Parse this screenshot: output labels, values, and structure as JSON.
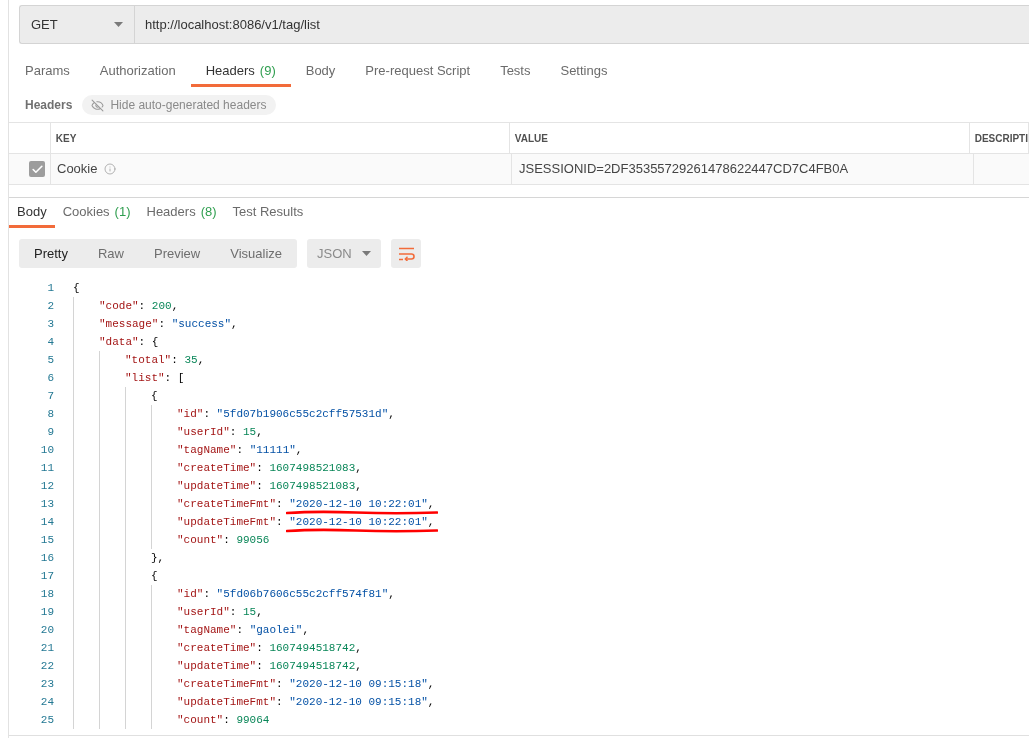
{
  "request": {
    "method": "GET",
    "url": "http://localhost:8086/v1/tag/list"
  },
  "request_tabs": [
    {
      "label": "Params",
      "selected": false
    },
    {
      "label": "Authorization",
      "selected": false
    },
    {
      "label": "Headers",
      "count": "(9)",
      "selected": true
    },
    {
      "label": "Body",
      "selected": false
    },
    {
      "label": "Pre-request Script",
      "selected": false
    },
    {
      "label": "Tests",
      "selected": false
    },
    {
      "label": "Settings",
      "selected": false
    }
  ],
  "headers_section": {
    "title": "Headers",
    "toggle": "Hide auto-generated headers"
  },
  "headers_table": {
    "columns": [
      "KEY",
      "VALUE",
      "DESCRIPTI"
    ],
    "rows": [
      {
        "checked": true,
        "key": "Cookie",
        "value": "JSESSIONID=2DF35355729261478622447CD7C4FB0A"
      }
    ]
  },
  "response_tabs": [
    {
      "label": "Body",
      "selected": true
    },
    {
      "label": "Cookies",
      "count": "(1)",
      "selected": false
    },
    {
      "label": "Headers",
      "count": "(8)",
      "selected": false
    },
    {
      "label": "Test Results",
      "selected": false
    }
  ],
  "view_modes": [
    {
      "label": "Pretty",
      "selected": true
    },
    {
      "label": "Raw",
      "selected": false
    },
    {
      "label": "Preview",
      "selected": false
    },
    {
      "label": "Visualize",
      "selected": false
    }
  ],
  "format": "JSON",
  "code": {
    "lines": [
      {
        "number": "1",
        "underlined": false,
        "tokens": [
          {
            "kind": "punct",
            "text": "{"
          }
        ],
        "children": [
          {
            "number": "2",
            "underlined": false,
            "tokens": [
              {
                "kind": "key",
                "text": "\"code\""
              },
              {
                "kind": "punct",
                "text": ": "
              },
              {
                "kind": "number",
                "text": "200"
              },
              {
                "kind": "punct",
                "text": ","
              }
            ]
          },
          {
            "number": "3",
            "underlined": false,
            "tokens": [
              {
                "kind": "key",
                "text": "\"message\""
              },
              {
                "kind": "punct",
                "text": ": "
              },
              {
                "kind": "string",
                "text": "\"success\""
              },
              {
                "kind": "punct",
                "text": ","
              }
            ]
          },
          {
            "number": "4",
            "underlined": false,
            "tokens": [
              {
                "kind": "key",
                "text": "\"data\""
              },
              {
                "kind": "punct",
                "text": ": {"
              }
            ],
            "children": [
              {
                "number": "5",
                "underlined": false,
                "tokens": [
                  {
                    "kind": "key",
                    "text": "\"total\""
                  },
                  {
                    "kind": "punct",
                    "text": ": "
                  },
                  {
                    "kind": "number",
                    "text": "35"
                  },
                  {
                    "kind": "punct",
                    "text": ","
                  }
                ]
              },
              {
                "number": "6",
                "underlined": false,
                "tokens": [
                  {
                    "kind": "key",
                    "text": "\"list\""
                  },
                  {
                    "kind": "punct",
                    "text": ": ["
                  }
                ],
                "children": [
                  {
                    "number": "7",
                    "underlined": false,
                    "tokens": [
                      {
                        "kind": "punct",
                        "text": "{"
                      }
                    ],
                    "children": [
                      {
                        "number": "8",
                        "underlined": false,
                        "tokens": [
                          {
                            "kind": "key",
                            "text": "\"id\""
                          },
                          {
                            "kind": "punct",
                            "text": ": "
                          },
                          {
                            "kind": "string",
                            "text": "\"5fd07b1906c55c2cff57531d\""
                          },
                          {
                            "kind": "punct",
                            "text": ","
                          }
                        ]
                      },
                      {
                        "number": "9",
                        "underlined": false,
                        "tokens": [
                          {
                            "kind": "key",
                            "text": "\"userId\""
                          },
                          {
                            "kind": "punct",
                            "text": ": "
                          },
                          {
                            "kind": "number",
                            "text": "15"
                          },
                          {
                            "kind": "punct",
                            "text": ","
                          }
                        ]
                      },
                      {
                        "number": "10",
                        "underlined": false,
                        "tokens": [
                          {
                            "kind": "key",
                            "text": "\"tagName\""
                          },
                          {
                            "kind": "punct",
                            "text": ": "
                          },
                          {
                            "kind": "string",
                            "text": "\"11111\""
                          },
                          {
                            "kind": "punct",
                            "text": ","
                          }
                        ]
                      },
                      {
                        "number": "11",
                        "underlined": false,
                        "tokens": [
                          {
                            "kind": "key",
                            "text": "\"createTime\""
                          },
                          {
                            "kind": "punct",
                            "text": ": "
                          },
                          {
                            "kind": "number",
                            "text": "1607498521083"
                          },
                          {
                            "kind": "punct",
                            "text": ","
                          }
                        ]
                      },
                      {
                        "number": "12",
                        "underlined": false,
                        "tokens": [
                          {
                            "kind": "key",
                            "text": "\"updateTime\""
                          },
                          {
                            "kind": "punct",
                            "text": ": "
                          },
                          {
                            "kind": "number",
                            "text": "1607498521083"
                          },
                          {
                            "kind": "punct",
                            "text": ","
                          }
                        ]
                      },
                      {
                        "number": "13",
                        "underlined": true,
                        "tokens": [
                          {
                            "kind": "key",
                            "text": "\"createTimeFmt\""
                          },
                          {
                            "kind": "punct",
                            "text": ": "
                          },
                          {
                            "kind": "string",
                            "text": "\"2020-12-10 10:22:01\""
                          },
                          {
                            "kind": "punct",
                            "text": ","
                          }
                        ]
                      },
                      {
                        "number": "14",
                        "underlined": true,
                        "tokens": [
                          {
                            "kind": "key",
                            "text": "\"updateTimeFmt\""
                          },
                          {
                            "kind": "punct",
                            "text": ": "
                          },
                          {
                            "kind": "string",
                            "text": "\"2020-12-10 10:22:01\""
                          },
                          {
                            "kind": "punct",
                            "text": ","
                          }
                        ]
                      },
                      {
                        "number": "15",
                        "underlined": false,
                        "tokens": [
                          {
                            "kind": "key",
                            "text": "\"count\""
                          },
                          {
                            "kind": "punct",
                            "text": ": "
                          },
                          {
                            "kind": "number",
                            "text": "99056"
                          }
                        ]
                      }
                    ]
                  },
                  {
                    "number": "16",
                    "underlined": false,
                    "tokens": [
                      {
                        "kind": "punct",
                        "text": "},"
                      }
                    ]
                  },
                  {
                    "number": "17",
                    "underlined": false,
                    "tokens": [
                      {
                        "kind": "punct",
                        "text": "{"
                      }
                    ],
                    "children": [
                      {
                        "number": "18",
                        "underlined": false,
                        "tokens": [
                          {
                            "kind": "key",
                            "text": "\"id\""
                          },
                          {
                            "kind": "punct",
                            "text": ": "
                          },
                          {
                            "kind": "string",
                            "text": "\"5fd06b7606c55c2cff574f81\""
                          },
                          {
                            "kind": "punct",
                            "text": ","
                          }
                        ]
                      },
                      {
                        "number": "19",
                        "underlined": false,
                        "tokens": [
                          {
                            "kind": "key",
                            "text": "\"userId\""
                          },
                          {
                            "kind": "punct",
                            "text": ": "
                          },
                          {
                            "kind": "number",
                            "text": "15"
                          },
                          {
                            "kind": "punct",
                            "text": ","
                          }
                        ]
                      },
                      {
                        "number": "20",
                        "underlined": false,
                        "tokens": [
                          {
                            "kind": "key",
                            "text": "\"tagName\""
                          },
                          {
                            "kind": "punct",
                            "text": ": "
                          },
                          {
                            "kind": "string",
                            "text": "\"gaolei\""
                          },
                          {
                            "kind": "punct",
                            "text": ","
                          }
                        ]
                      },
                      {
                        "number": "21",
                        "underlined": false,
                        "tokens": [
                          {
                            "kind": "key",
                            "text": "\"createTime\""
                          },
                          {
                            "kind": "punct",
                            "text": ": "
                          },
                          {
                            "kind": "number",
                            "text": "1607494518742"
                          },
                          {
                            "kind": "punct",
                            "text": ","
                          }
                        ]
                      },
                      {
                        "number": "22",
                        "underlined": false,
                        "tokens": [
                          {
                            "kind": "key",
                            "text": "\"updateTime\""
                          },
                          {
                            "kind": "punct",
                            "text": ": "
                          },
                          {
                            "kind": "number",
                            "text": "1607494518742"
                          },
                          {
                            "kind": "punct",
                            "text": ","
                          }
                        ]
                      },
                      {
                        "number": "23",
                        "underlined": false,
                        "tokens": [
                          {
                            "kind": "key",
                            "text": "\"createTimeFmt\""
                          },
                          {
                            "kind": "punct",
                            "text": ": "
                          },
                          {
                            "kind": "string",
                            "text": "\"2020-12-10 09:15:18\""
                          },
                          {
                            "kind": "punct",
                            "text": ","
                          }
                        ]
                      },
                      {
                        "number": "24",
                        "underlined": false,
                        "tokens": [
                          {
                            "kind": "key",
                            "text": "\"updateTimeFmt\""
                          },
                          {
                            "kind": "punct",
                            "text": ": "
                          },
                          {
                            "kind": "string",
                            "text": "\"2020-12-10 09:15:18\""
                          },
                          {
                            "kind": "punct",
                            "text": ","
                          }
                        ]
                      },
                      {
                        "number": "25",
                        "underlined": false,
                        "tokens": [
                          {
                            "kind": "key",
                            "text": "\"count\""
                          },
                          {
                            "kind": "punct",
                            "text": ": "
                          },
                          {
                            "kind": "number",
                            "text": "99064"
                          }
                        ]
                      }
                    ]
                  }
                ]
              }
            ]
          }
        ]
      }
    ]
  }
}
